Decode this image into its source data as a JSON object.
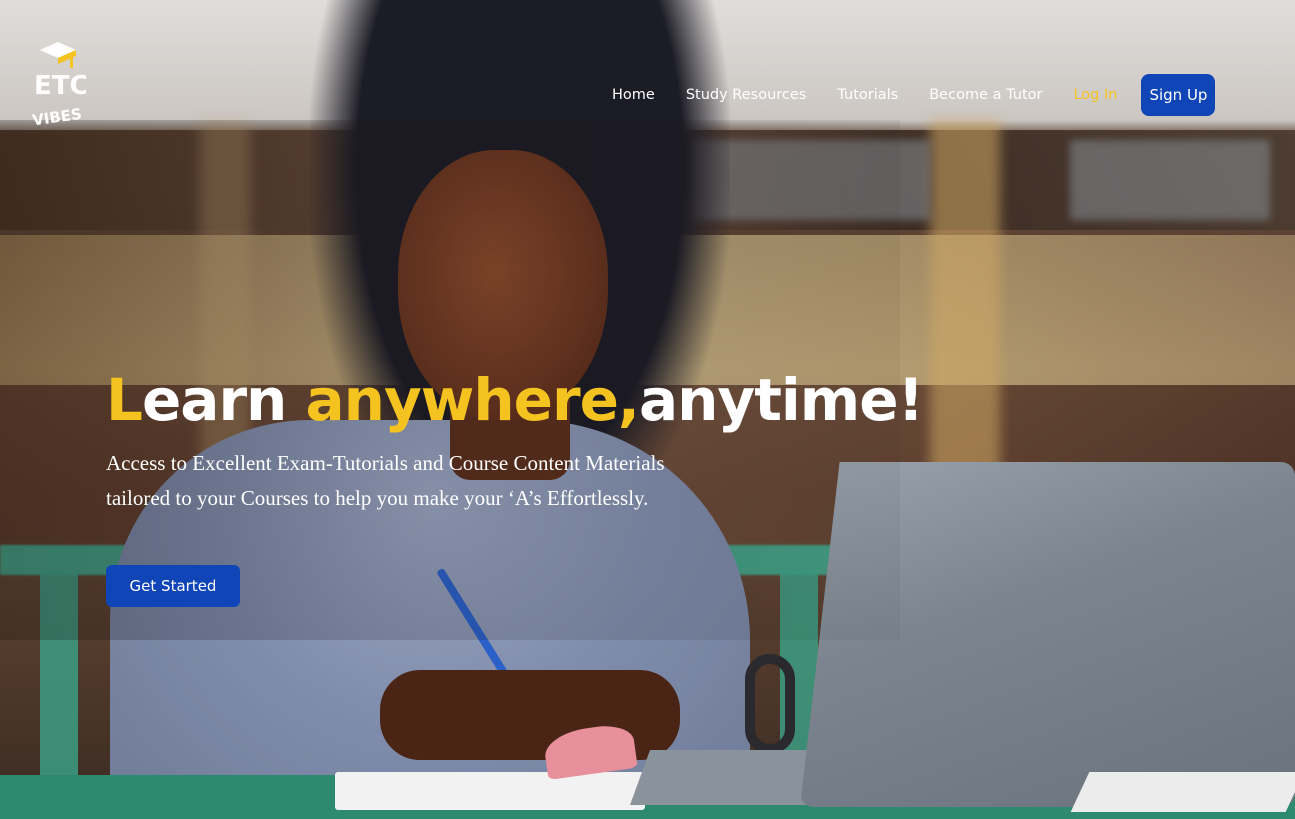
{
  "brand": {
    "logo_text_top": "ETC",
    "logo_text_bottom": "VIBES",
    "accent_color": "#f5c320",
    "primary_color": "#0f45b7"
  },
  "nav": {
    "items": [
      {
        "label": "Home"
      },
      {
        "label": "Study Resources"
      },
      {
        "label": "Tutorials"
      },
      {
        "label": "Become a Tutor"
      }
    ],
    "login_label": "Log In",
    "signup_label": "Sign Up"
  },
  "hero": {
    "headline_first_letter": "L",
    "headline_rest": "earn ",
    "headline_highlight": "anywhere,",
    "headline_end": "anytime!",
    "subtitle": "Access to Excellent Exam-Tutorials and Course Content Materials tailored to your Courses to help you make your ‘A’s Effortlessly.",
    "cta_label": "Get Started"
  },
  "background_image": {
    "subject": "student-writing-with-laptop"
  }
}
